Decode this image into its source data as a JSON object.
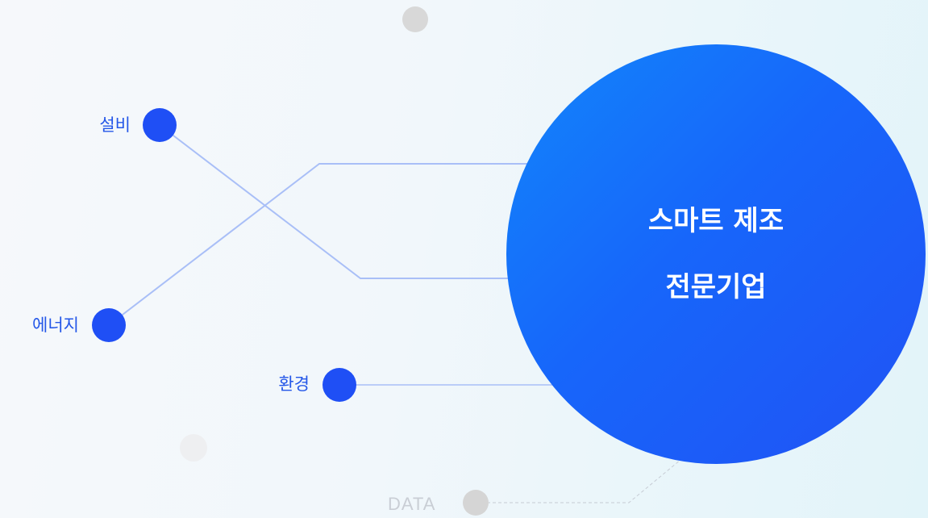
{
  "hub": {
    "line1": "스마트 제조",
    "line2": "전문기업"
  },
  "nodes": {
    "equipment": "설비",
    "energy": "에너지",
    "environment": "환경",
    "data": "DATA"
  },
  "colors": {
    "node_fill": "#1f4ff5",
    "connector": "#a9bff7",
    "hub_gradient_start": "#1286fb",
    "hub_gradient_end": "#2152f5",
    "decor_gray": "#d6d6d6",
    "data_label": "#c9ced5"
  }
}
